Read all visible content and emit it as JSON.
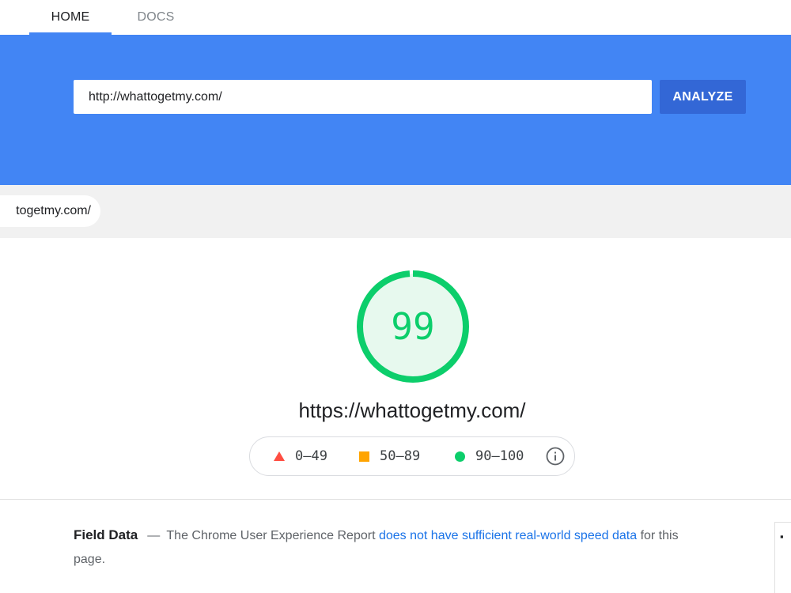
{
  "nav": {
    "tabs": [
      {
        "label": "HOME",
        "active": true
      },
      {
        "label": "DOCS",
        "active": false
      }
    ]
  },
  "search": {
    "value": "http://whattogetmy.com/",
    "button_label": "ANALYZE"
  },
  "url_chip": {
    "label": "togetmy.com/"
  },
  "report": {
    "score": "99",
    "score_fraction": 0.99,
    "final_url": "https://whattogetmy.com/"
  },
  "legend": {
    "fail": "0–49",
    "average": "50–89",
    "pass": "90–100"
  },
  "field_data": {
    "title": "Field Data",
    "dash": "—",
    "text_before": "The Chrome User Experience Report",
    "link": "does not have sufficient real-world speed data",
    "text_after": "for this page."
  },
  "colors": {
    "brand_blue": "#4285f4",
    "button_blue": "#3367d6",
    "pass_green": "#0cce6b",
    "average_orange": "#ffa400",
    "fail_red": "#ff4e42",
    "link_blue": "#1a73e8"
  },
  "icons": {
    "info": "info-circle-icon",
    "fail": "triangle-icon",
    "average": "square-icon",
    "pass": "circle-icon"
  }
}
